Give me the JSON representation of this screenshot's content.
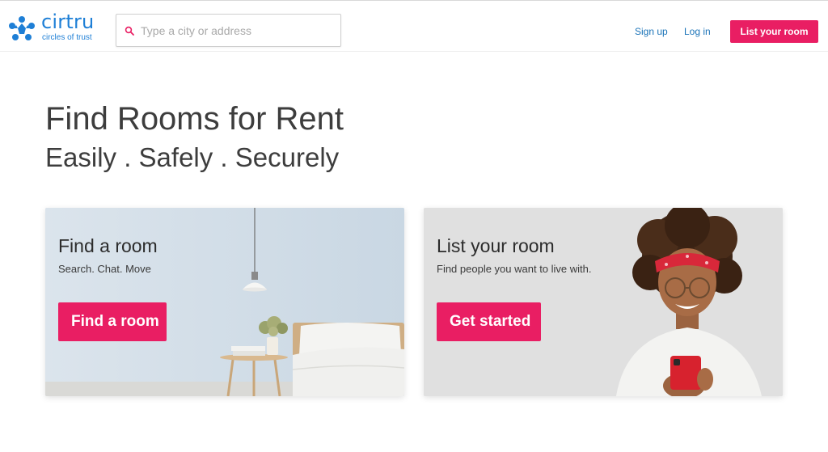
{
  "header": {
    "logo": {
      "name": "cirtru",
      "tagline": "circles of trust"
    },
    "search": {
      "placeholder": "Type a city or address",
      "value": ""
    },
    "nav": {
      "signup": "Sign up",
      "login": "Log in",
      "list_room": "List your room"
    }
  },
  "hero": {
    "title": "Find Rooms for Rent",
    "subtitle": "Easily . Safely . Securely"
  },
  "cards": {
    "find": {
      "title": "Find a room",
      "text": "Search. Chat. Move",
      "button": "Find a room"
    },
    "list": {
      "title": "List your room",
      "text": "Find people you want to live with.",
      "button": "Get started"
    }
  },
  "colors": {
    "brand_blue": "#1e7fd6",
    "accent_pink": "#e91e63",
    "link_blue": "#1a73b8",
    "heading_text": "#3d3d3d"
  },
  "icons": {
    "logo": "five-people-circle-icon",
    "search": "magnifier-icon"
  }
}
